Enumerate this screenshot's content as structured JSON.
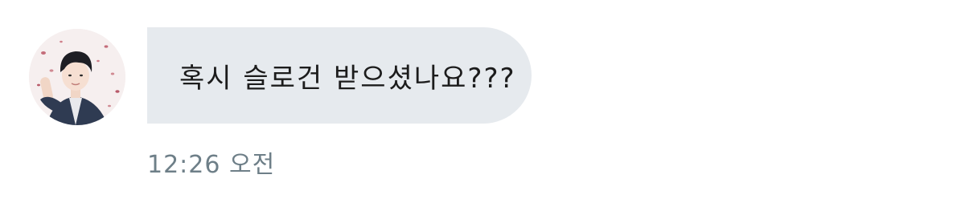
{
  "message": {
    "text": "혹시 슬로건 받으셨나요???",
    "time": "12:26 오전",
    "avatar": "profile-photo"
  },
  "colors": {
    "bubble": "#e6eaee",
    "text": "#1c1c1c",
    "time": "#6e7f88"
  }
}
